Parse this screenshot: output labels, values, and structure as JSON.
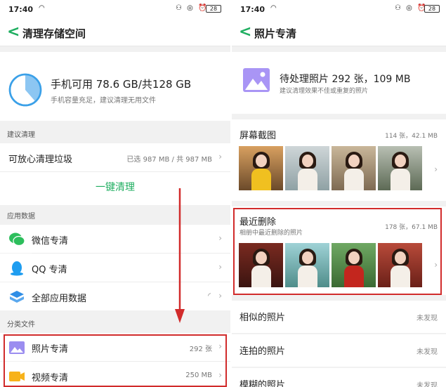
{
  "left": {
    "status": {
      "time": "17:40",
      "icons": "⚇ ◎ ⏰",
      "battery": "28"
    },
    "title": "清理存储空间",
    "storage": {
      "title": "手机可用 78.6 GB/共128 GB",
      "subtitle": "手机容量充足，建议清理无用文件",
      "used_fraction": 0.386
    },
    "section_suggest": "建议清理",
    "junk": {
      "label": "可放心清理垃圾",
      "value": "已选 987 MB / 共 987 MB"
    },
    "clean_button": "一键清理",
    "section_apps": "应用数据",
    "apps": [
      {
        "label": "微信专清",
        "icon": "wechat-icon"
      },
      {
        "label": "QQ 专清",
        "icon": "qq-icon"
      },
      {
        "label": "全部应用数据",
        "icon": "apps-icon"
      }
    ],
    "section_files": "分类文件",
    "files": [
      {
        "label": "照片专清",
        "value": "292 张",
        "icon": "photo-icon"
      },
      {
        "label": "视频专清",
        "value": "250 MB",
        "icon": "video-icon"
      }
    ],
    "accent": "#1fae60"
  },
  "right": {
    "status": {
      "time": "17:40",
      "icons": "⚇ ◎ ⏰",
      "battery": "28"
    },
    "title": "照片专清",
    "pending": {
      "title": "待处理照片 292 张，109 MB",
      "subtitle": "建议清理效果不佳或重复的照片"
    },
    "screenshots": {
      "title": "屏幕截图",
      "count": "114 张，42.1 MB"
    },
    "recent": {
      "title": "最近删除",
      "desc": "相册中最近删除的照片",
      "count": "178 张，67.1 MB"
    },
    "rows": [
      {
        "title": "相似的照片",
        "value": "未发现"
      },
      {
        "title": "连拍的照片",
        "value": "未发现"
      },
      {
        "title": "模糊的照片",
        "value": "未发现"
      }
    ],
    "highlight_color": "#d12b2b"
  }
}
